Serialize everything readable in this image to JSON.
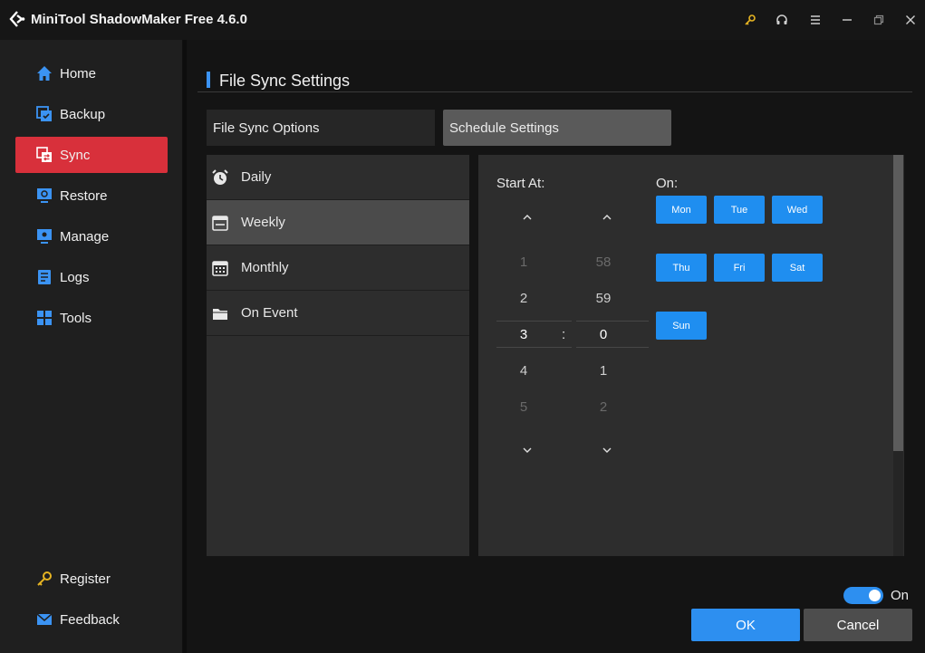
{
  "window": {
    "title": "MiniTool ShadowMaker Free 4.6.0",
    "controls": [
      "key-icon",
      "headset-icon",
      "menu-icon",
      "minimize-icon",
      "restore-icon",
      "close-icon"
    ]
  },
  "sidebar": {
    "items": [
      {
        "label": "Home",
        "icon": "home-icon"
      },
      {
        "label": "Backup",
        "icon": "backup-icon"
      },
      {
        "label": "Sync",
        "icon": "sync-icon",
        "active": true
      },
      {
        "label": "Restore",
        "icon": "restore-icon"
      },
      {
        "label": "Manage",
        "icon": "manage-icon"
      },
      {
        "label": "Logs",
        "icon": "logs-icon"
      },
      {
        "label": "Tools",
        "icon": "tools-icon"
      }
    ],
    "bottom": [
      {
        "label": "Register",
        "icon": "key-icon"
      },
      {
        "label": "Feedback",
        "icon": "mail-icon"
      }
    ]
  },
  "page": {
    "title": "File Sync Settings",
    "tabs": [
      "File Sync Options",
      "Schedule Settings"
    ],
    "active_tab": "Schedule Settings"
  },
  "schedule": {
    "modes": [
      {
        "label": "Daily",
        "icon": "alarm-clock-icon"
      },
      {
        "label": "Weekly",
        "icon": "calendar-week-icon",
        "active": true
      },
      {
        "label": "Monthly",
        "icon": "calendar-month-icon"
      },
      {
        "label": "On Event",
        "icon": "folder-icon"
      }
    ],
    "start_at_label": "Start At:",
    "hour_values": [
      "1",
      "2",
      "3",
      "4",
      "5"
    ],
    "minute_values": [
      "58",
      "59",
      "0",
      "1",
      "2"
    ],
    "separator": ":",
    "on_label": "On:",
    "days": [
      "Mon",
      "Tue",
      "Wed",
      "Thu",
      "Fri",
      "Sat",
      "Sun"
    ]
  },
  "footer": {
    "toggle_label": "On",
    "toggle_on": true,
    "ok_label": "OK",
    "cancel_label": "Cancel"
  },
  "colors": {
    "accent": "#2d8ff0",
    "active_nav": "#d8303b",
    "background": "#141414"
  }
}
